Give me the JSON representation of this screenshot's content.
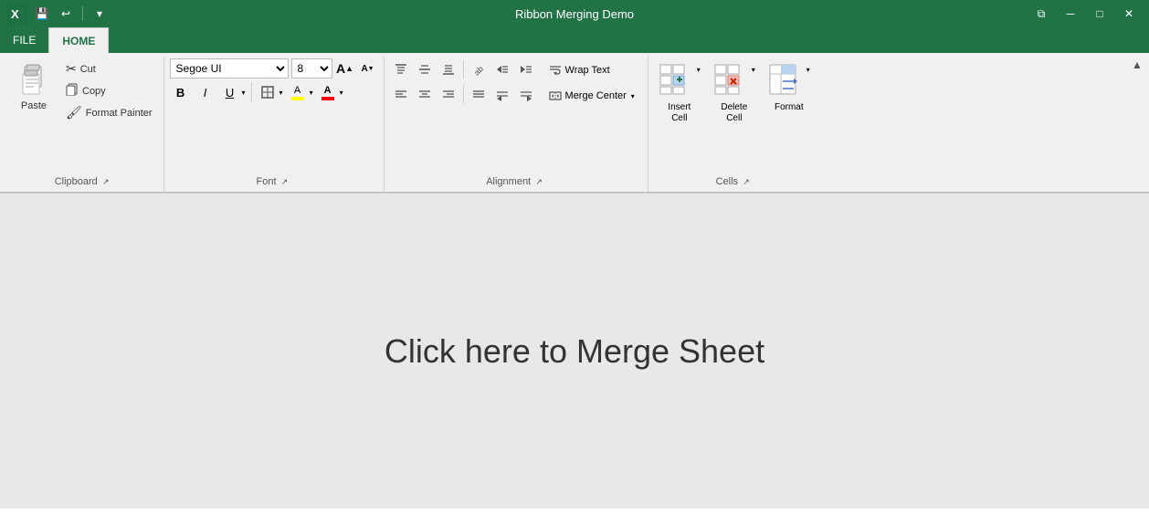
{
  "window": {
    "title": "Ribbon Merging Demo",
    "xl_logo": "X",
    "qat": {
      "save_label": "💾",
      "undo_label": "↩",
      "dropdown_label": "▾"
    },
    "win_buttons": {
      "restore": "⧉",
      "minimize": "─",
      "maximize": "□",
      "close": "✕"
    }
  },
  "tabs": [
    {
      "id": "file",
      "label": "FILE",
      "active": false
    },
    {
      "id": "home",
      "label": "HOME",
      "active": true
    }
  ],
  "ribbon": {
    "groups": {
      "clipboard": {
        "label": "Clipboard",
        "paste_label": "Paste",
        "cut_label": "Cut",
        "copy_label": "Copy",
        "format_painter_label": "Format Painter"
      },
      "font": {
        "label": "Font",
        "font_name": "Segoe UI",
        "font_size": "8",
        "bold": "B",
        "italic": "I",
        "underline": "U",
        "increase_size": "A",
        "decrease_size": "A"
      },
      "alignment": {
        "label": "Alignment",
        "wrap_text_label": "Wrap Text",
        "merge_center_label": "Merge  Center"
      },
      "cells": {
        "label": "Cells",
        "insert_label": "Insert\nCell",
        "delete_label": "Delete\nCell",
        "format_label": "Format"
      }
    }
  },
  "main": {
    "content_text": "Click here to Merge Sheet"
  }
}
